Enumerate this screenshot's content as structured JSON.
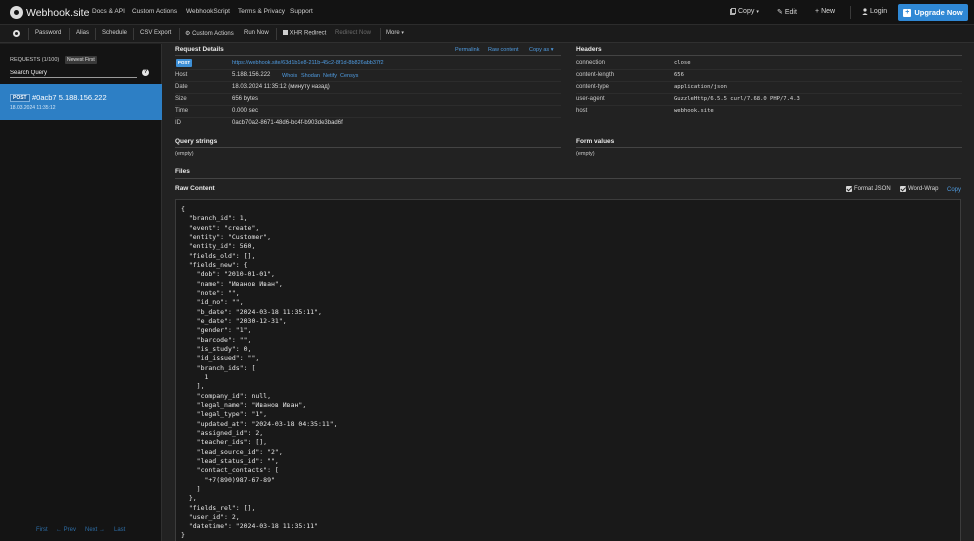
{
  "navbar": {
    "brand": "Webhook.site",
    "links": [
      "Docs & API",
      "Custom Actions",
      "WebhookScript",
      "Terms & Privacy",
      "Support"
    ],
    "copy": "Copy",
    "edit": "Edit",
    "new": "New",
    "login": "Login",
    "upgrade": "Upgrade Now"
  },
  "toolbar": {
    "items": [
      "Password",
      "Alias",
      "Schedule",
      "CSV Export",
      "Custom Actions",
      "Run Now",
      "XHR Redirect",
      "Redirect Now",
      "More"
    ]
  },
  "sidebar": {
    "requests_label": "REQUESTS (1/100)",
    "newest_first": "Newest First",
    "search_placeholder": "Search Query",
    "request": {
      "method": "POST",
      "title": "#0acb7 5.188.156.222",
      "date": "18.03.2024 11:35:12"
    },
    "pager": [
      "First",
      "← Prev",
      "Next →",
      "Last"
    ]
  },
  "request_details": {
    "title": "Request Details",
    "actions": [
      "Permalink",
      "Raw content",
      "Copy as"
    ],
    "method": "POST",
    "url": "https://webhook.site/63d1b1e8-211b-45c2-8f1d-8b826abb37f2",
    "host_label": "Host",
    "host": "5.188.156.222",
    "host_links": [
      "Whois",
      "Shodan",
      "Netify",
      "Censys"
    ],
    "date_label": "Date",
    "date": "18.03.2024 11:35:12 (минуту назад)",
    "size_label": "Size",
    "size": "656 bytes",
    "time_label": "Time",
    "time": "0.000 sec",
    "id_label": "ID",
    "id": "0acb70a2-8671-48d6-bc4f-b903de3bad6f"
  },
  "headers": {
    "title": "Headers",
    "rows": [
      {
        "key": "connection",
        "value": "close"
      },
      {
        "key": "content-length",
        "value": "656"
      },
      {
        "key": "content-type",
        "value": "application/json"
      },
      {
        "key": "user-agent",
        "value": "GuzzleHttp/6.5.5 curl/7.68.0 PHP/7.4.3"
      },
      {
        "key": "host",
        "value": "webhook.site"
      }
    ]
  },
  "query_strings": {
    "title": "Query strings",
    "value": "(empty)"
  },
  "form_values": {
    "title": "Form values",
    "value": "(empty)"
  },
  "files": {
    "title": "Files"
  },
  "raw_content": {
    "title": "Raw Content",
    "format_json": "Format JSON",
    "word_wrap": "Word-Wrap",
    "copy": "Copy",
    "body": "{\n  \"branch_id\": 1,\n  \"event\": \"create\",\n  \"entity\": \"Customer\",\n  \"entity_id\": 560,\n  \"fields_old\": [],\n  \"fields_new\": {\n    \"dob\": \"2010-01-01\",\n    \"name\": \"Иванов Иван\",\n    \"note\": \"\",\n    \"id_no\": \"\",\n    \"b_date\": \"2024-03-18 11:35:11\",\n    \"e_date\": \"2030-12-31\",\n    \"gender\": \"1\",\n    \"barcode\": \"\",\n    \"is_study\": 0,\n    \"id_issued\": \"\",\n    \"branch_ids\": [\n      1\n    ],\n    \"company_id\": null,\n    \"legal_name\": \"Иванов Иван\",\n    \"legal_type\": \"1\",\n    \"updated_at\": \"2024-03-18 04:35:11\",\n    \"assigned_id\": 2,\n    \"teacher_ids\": [],\n    \"lead_source_id\": \"2\",\n    \"lead_status_id\": \"\",\n    \"contact_contacts\": [\n      \"+7(890)987-67-89\"\n    ]\n  },\n  \"fields_rel\": [],\n  \"user_id\": 2,\n  \"datetime\": \"2024-03-18 11:35:11\"\n}"
  }
}
